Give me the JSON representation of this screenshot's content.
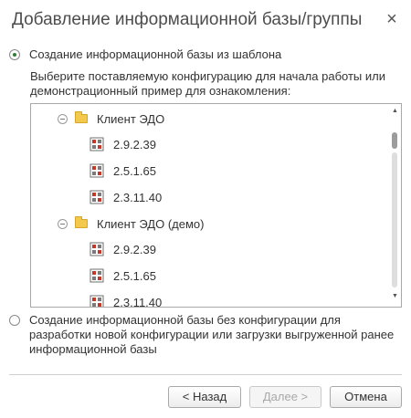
{
  "dialog": {
    "title": "Добавление информационной базы/группы",
    "close_glyph": "×"
  },
  "option_template": {
    "label": "Создание информационной базы из шаблона",
    "selected": true,
    "hint": "Выберите поставляемую конфигурацию для начала работы или демонстрационный пример для ознакомления:"
  },
  "tree": {
    "groups": [
      {
        "label": "Клиент ЭДО",
        "items": [
          "2.9.2.39",
          "2.5.1.65",
          "2.3.11.40"
        ]
      },
      {
        "label": "Клиент ЭДО (демо)",
        "items": [
          "2.9.2.39",
          "2.5.1.65",
          "2.3.11.40"
        ]
      }
    ],
    "icons": {
      "group": "folder-icon",
      "item": "configuration-icon",
      "expander": "collapse-icon"
    },
    "scrollbar": {
      "up": "▲",
      "down": "▼"
    }
  },
  "option_empty": {
    "label": "Создание информационной базы без конфигурации для разработки новой конфигурации или загрузки выгруженной ранее информационной базы",
    "selected": false
  },
  "buttons": {
    "back": "< Назад",
    "next": "Далее >",
    "cancel": "Отмена"
  },
  "colors": {
    "radio_selected": "#2e7d32",
    "folder": "#f2c94c"
  }
}
